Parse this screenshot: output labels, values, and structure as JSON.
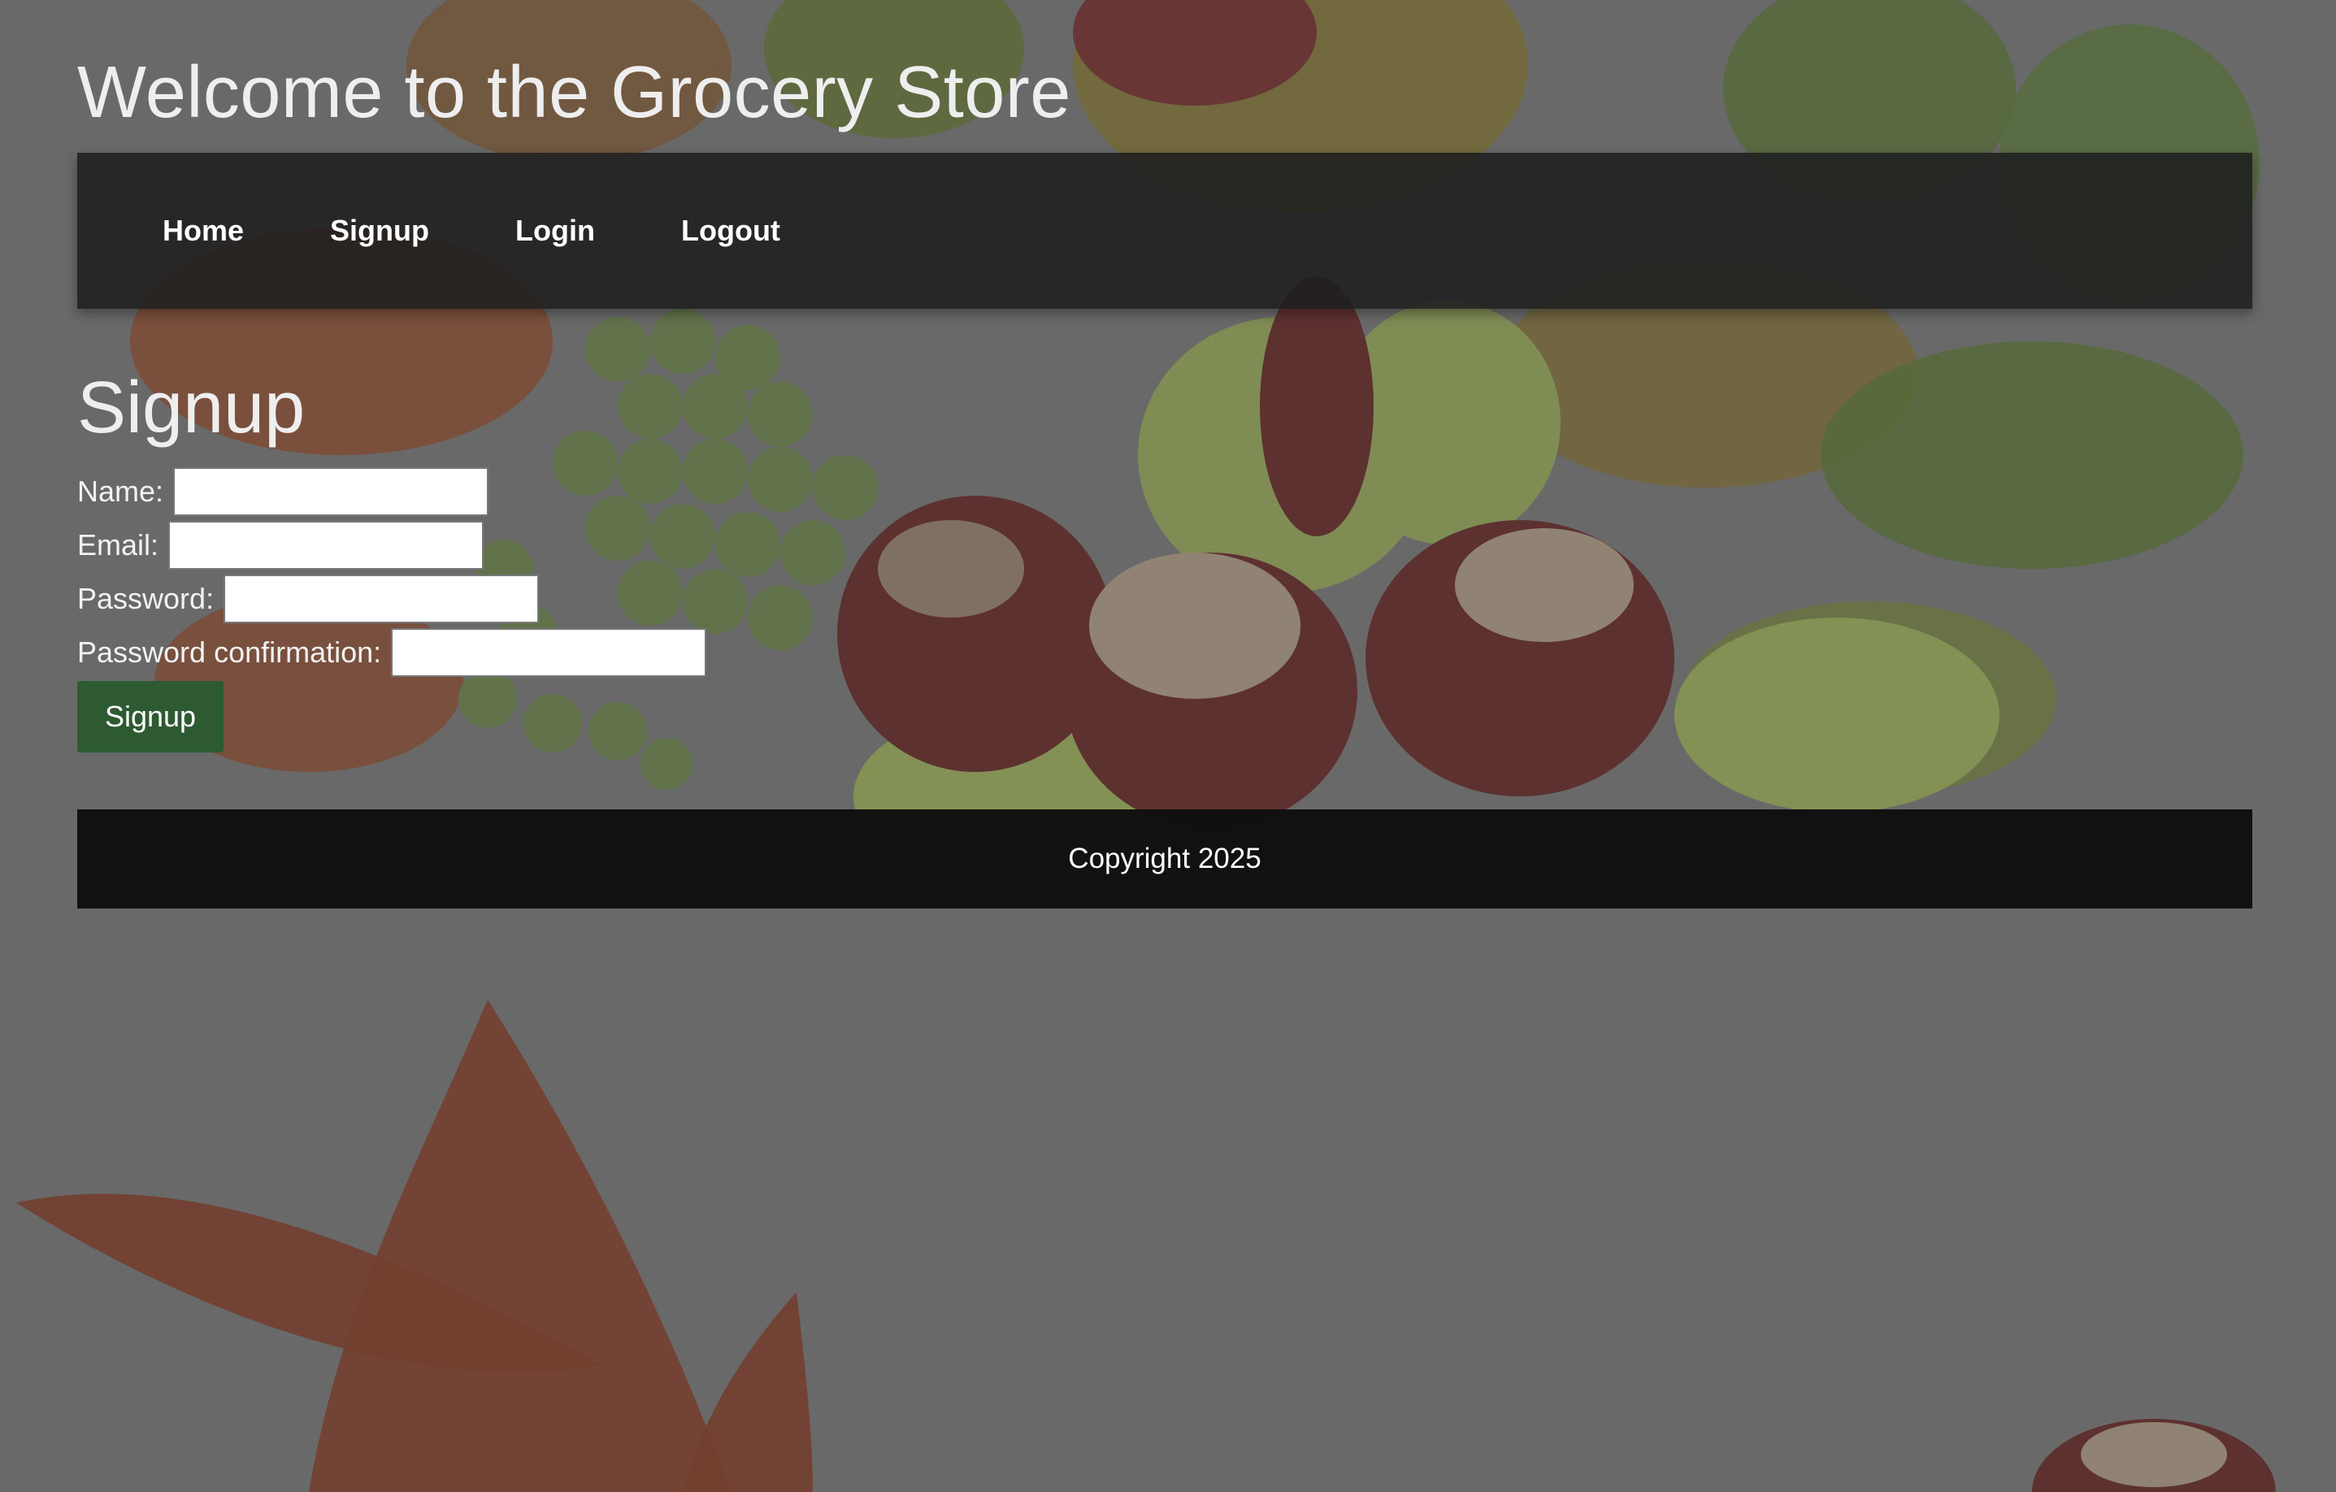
{
  "header": {
    "title": "Welcome to the Grocery Store"
  },
  "nav": {
    "items": [
      {
        "label": "Home"
      },
      {
        "label": "Signup"
      },
      {
        "label": "Login"
      },
      {
        "label": "Logout"
      }
    ]
  },
  "main": {
    "heading": "Signup",
    "form": {
      "fields": [
        {
          "label": "Name:",
          "value": ""
        },
        {
          "label": "Email:",
          "value": ""
        },
        {
          "label": "Password:",
          "value": ""
        },
        {
          "label": "Password confirmation:",
          "value": ""
        }
      ],
      "submit_label": "Signup"
    }
  },
  "footer": {
    "text": "Copyright 2025"
  },
  "colors": {
    "page_overlay": "#666666",
    "navbar": "#1e1e1e",
    "footer": "#0e0e0e",
    "button": "#2e5a31"
  }
}
